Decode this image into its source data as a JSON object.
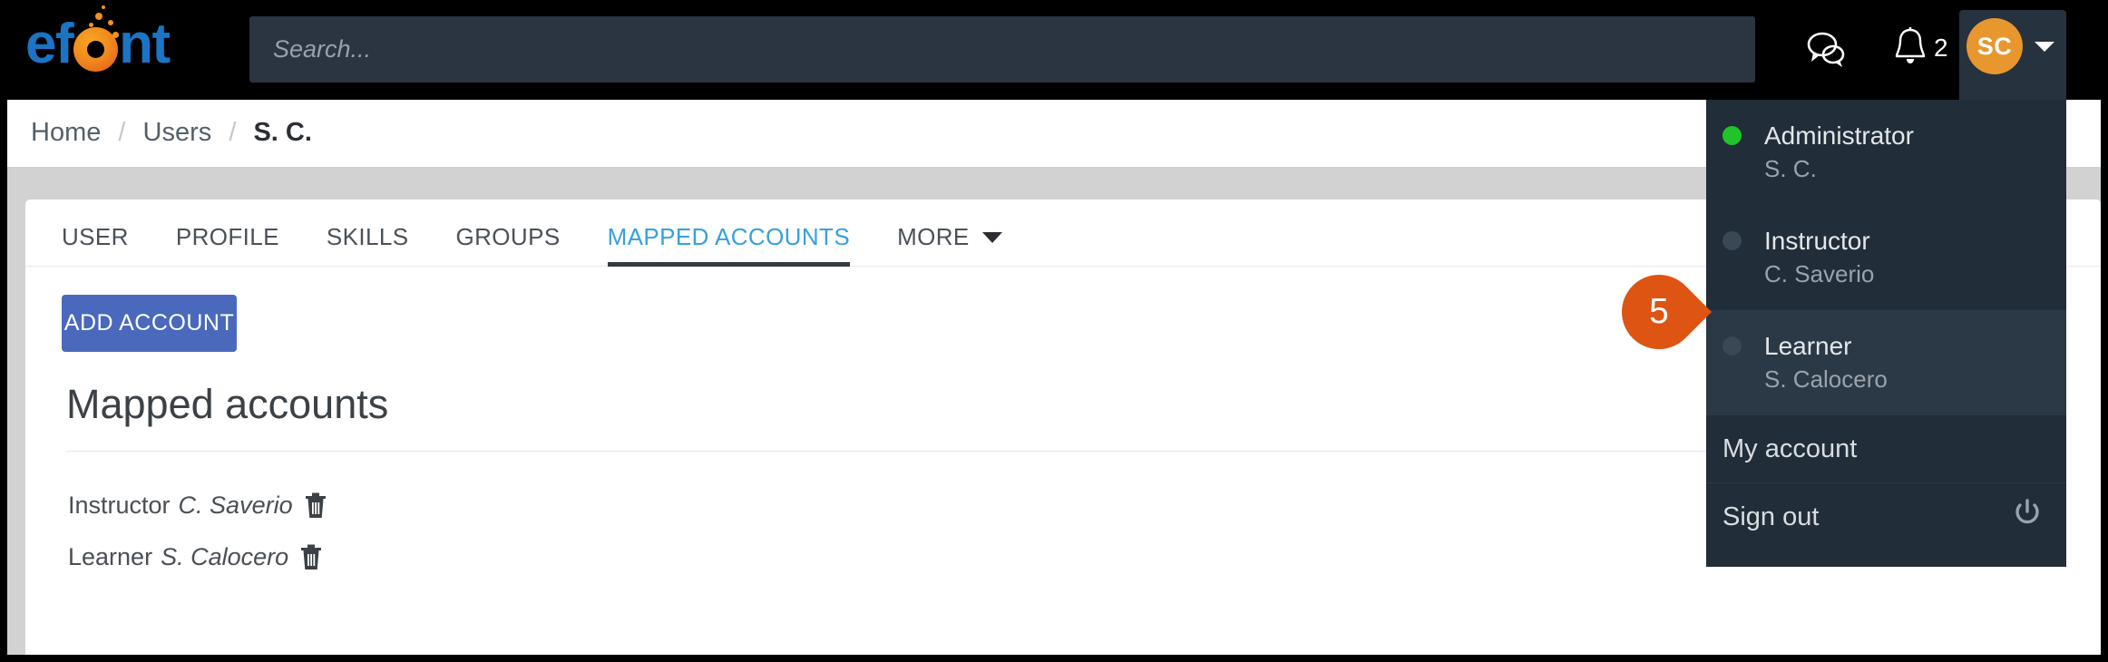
{
  "app": {
    "logo_text_before": "ef",
    "logo_letter_o": "o",
    "logo_text_after": "nt"
  },
  "header": {
    "search": {
      "placeholder": "Search...",
      "value": ""
    },
    "chat_icon": "chat-bubbles-icon",
    "bell_icon": "bell-icon",
    "notification_count": "2",
    "avatar_initials": "SC",
    "caret_icon": "chevron-down-icon"
  },
  "breadcrumb": {
    "items": [
      {
        "label": "Home",
        "current": false
      },
      {
        "label": "Users",
        "current": false
      },
      {
        "label": "S. C.",
        "current": true
      }
    ],
    "separator": "/"
  },
  "tabs": [
    {
      "label": "USER",
      "active": false
    },
    {
      "label": "PROFILE",
      "active": false
    },
    {
      "label": "SKILLS",
      "active": false
    },
    {
      "label": "GROUPS",
      "active": false
    },
    {
      "label": "MAPPED ACCOUNTS",
      "active": true
    },
    {
      "label": "MORE",
      "active": false,
      "has_caret": true
    }
  ],
  "main": {
    "add_account_label": "ADD ACCOUNT",
    "section_title": "Mapped accounts",
    "accounts": [
      {
        "role": "Instructor",
        "name": "C. Saverio",
        "delete_icon": "trash-icon"
      },
      {
        "role": "Learner",
        "name": "S. Calocero",
        "delete_icon": "trash-icon"
      }
    ]
  },
  "user_menu": {
    "roles": [
      {
        "role": "Administrator",
        "name": "S. C.",
        "active": true,
        "highlighted": false
      },
      {
        "role": "Instructor",
        "name": "C. Saverio",
        "active": false,
        "highlighted": false
      },
      {
        "role": "Learner",
        "name": "S. Calocero",
        "active": false,
        "highlighted": true
      }
    ],
    "my_account_label": "My account",
    "sign_out_label": "Sign out",
    "power_icon": "power-icon"
  },
  "callout": {
    "number": "5"
  },
  "colors": {
    "header_bg": "#000000",
    "accent_blue": "#38a0dd",
    "button_blue": "#4a69bd",
    "avatar_orange": "#e8962e",
    "callout_orange": "#dd5413",
    "menu_bg": "#212d39",
    "active_dot_green": "#22c32a",
    "page_gray": "#d2d2d2"
  }
}
